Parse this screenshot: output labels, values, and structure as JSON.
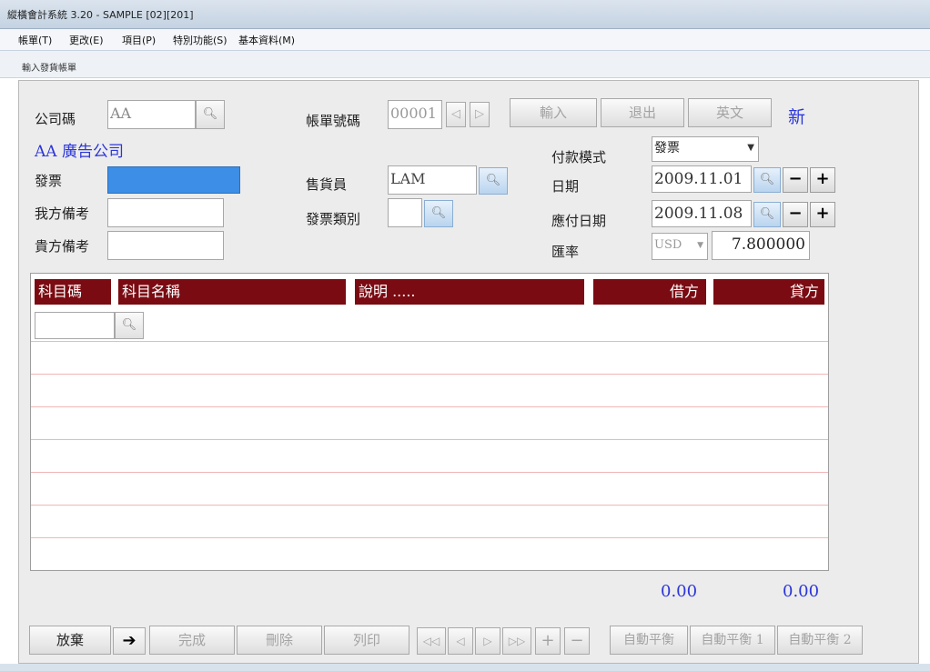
{
  "window": {
    "title": "縱橫會計系統 3.20 - SAMPLE [02][201]"
  },
  "menu": {
    "items": [
      "帳單(T)",
      "更改(E)",
      "項目(P)",
      "特別功能(S)",
      "基本資料(M)"
    ]
  },
  "form": {
    "title": "輸入發貨帳單",
    "company_code_label": "公司碼",
    "company_code_value": "AA",
    "company_name": "AA 廣告公司",
    "invoice_label": "發票",
    "invoice_value": "",
    "our_ref_label": "我方備考",
    "our_ref_value": "",
    "your_ref_label": "貴方備考",
    "your_ref_value": "",
    "bill_no_label": "帳單號碼",
    "bill_no_value": "00001",
    "prev_arrow": "◁",
    "next_arrow": "▷",
    "input_button": "輸入",
    "exit_button": "退出",
    "english_button": "英文",
    "status_new": "新",
    "salesman_label": "售貨員",
    "salesman_value": "LAM",
    "invoice_type_label": "發票類別",
    "invoice_type_value": "",
    "payment_mode_label": "付款模式",
    "payment_mode_value": "發票",
    "date_label": "日期",
    "date_value": "2009.11.01",
    "due_date_label": "應付日期",
    "due_date_value": "2009.11.08",
    "rate_label": "匯率",
    "currency_value": "USD",
    "rate_value": "7.800000",
    "minus": "−",
    "plus": "+"
  },
  "grid": {
    "col_code": "科目碼",
    "col_name": "科目名稱",
    "col_desc": "說明 .....",
    "col_debit": "借方",
    "col_credit": "貸方",
    "row_code_value": ""
  },
  "totals": {
    "debit": "0.00",
    "credit": "0.00"
  },
  "toolbar": {
    "abandon": "放棄",
    "arrow": "➔",
    "complete": "完成",
    "delete": "刪除",
    "print": "列印",
    "first": "◁◁",
    "prev": "◁",
    "next": "▷",
    "last": "▷▷",
    "add": "+",
    "remove": "−",
    "auto_balance": "自動平衡",
    "auto_balance_1": "自動平衡 1",
    "auto_balance_2": "自動平衡 2"
  }
}
